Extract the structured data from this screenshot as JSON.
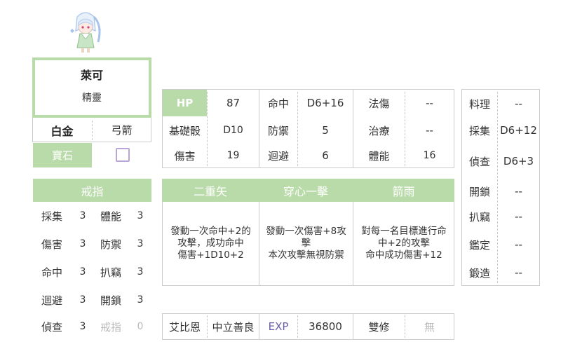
{
  "character": {
    "name": "萊可",
    "race": "精靈",
    "rank": "白金",
    "class": "弓箭",
    "gem_label": "寶石"
  },
  "ring": {
    "title": "戒指",
    "rows": [
      {
        "a_label": "採集",
        "a_val": "3",
        "b_label": "體能",
        "b_val": "3"
      },
      {
        "a_label": "傷害",
        "a_val": "3",
        "b_label": "防禦",
        "b_val": "3"
      },
      {
        "a_label": "命中",
        "a_val": "3",
        "b_label": "扒竊",
        "b_val": "3"
      },
      {
        "a_label": "迴避",
        "a_val": "3",
        "b_label": "開鎖",
        "b_val": "3"
      },
      {
        "a_label": "偵查",
        "a_val": "3",
        "b_label": "戒指",
        "b_val": "0"
      }
    ]
  },
  "stats": {
    "hp_label": "HP",
    "hp_val": "87",
    "hit_label": "命中",
    "hit_val": "D6+16",
    "mdmg_label": "法傷",
    "mdmg_val": "--",
    "dice_label": "基礎骰",
    "dice_val": "D10",
    "def_label": "防禦",
    "def_val": "5",
    "heal_label": "治療",
    "heal_val": "--",
    "dmg_label": "傷害",
    "dmg_val": "19",
    "eva_label": "迴避",
    "eva_val": "6",
    "phys_label": "體能",
    "phys_val": "16"
  },
  "skills": [
    {
      "name": "二重矢",
      "lines": [
        "發動一次命中+2的",
        "攻擊，成功命中",
        "傷害+1D10+2"
      ]
    },
    {
      "name": "穿心一擊",
      "lines": [
        "發動一次傷害+8攻",
        "擊",
        "本次攻擊無視防禦"
      ]
    },
    {
      "name": "箭雨",
      "lines": [
        "對每一名目標進行命",
        "中+2的攻擊",
        "命中成功傷害+12"
      ]
    }
  ],
  "bottom": {
    "deity": "艾比恩",
    "alignment": "中立善良",
    "exp_label": "EXP",
    "exp_val": "36800",
    "dual_label": "雙修",
    "dual_val": "無"
  },
  "abilities": [
    {
      "label": "料理",
      "val": "--"
    },
    {
      "label": "採集",
      "val": "D6+12"
    },
    {
      "label": "偵查",
      "val": "D6+3"
    },
    {
      "label": "開鎖",
      "val": "--"
    },
    {
      "label": "扒竊",
      "val": "--"
    },
    {
      "label": "鑑定",
      "val": "--"
    },
    {
      "label": "鍛造",
      "val": "--"
    }
  ],
  "colors": {
    "header_green": "#b9dba9",
    "accent_purple": "#6b5fa8",
    "checkbox": "#b9a6d8"
  }
}
